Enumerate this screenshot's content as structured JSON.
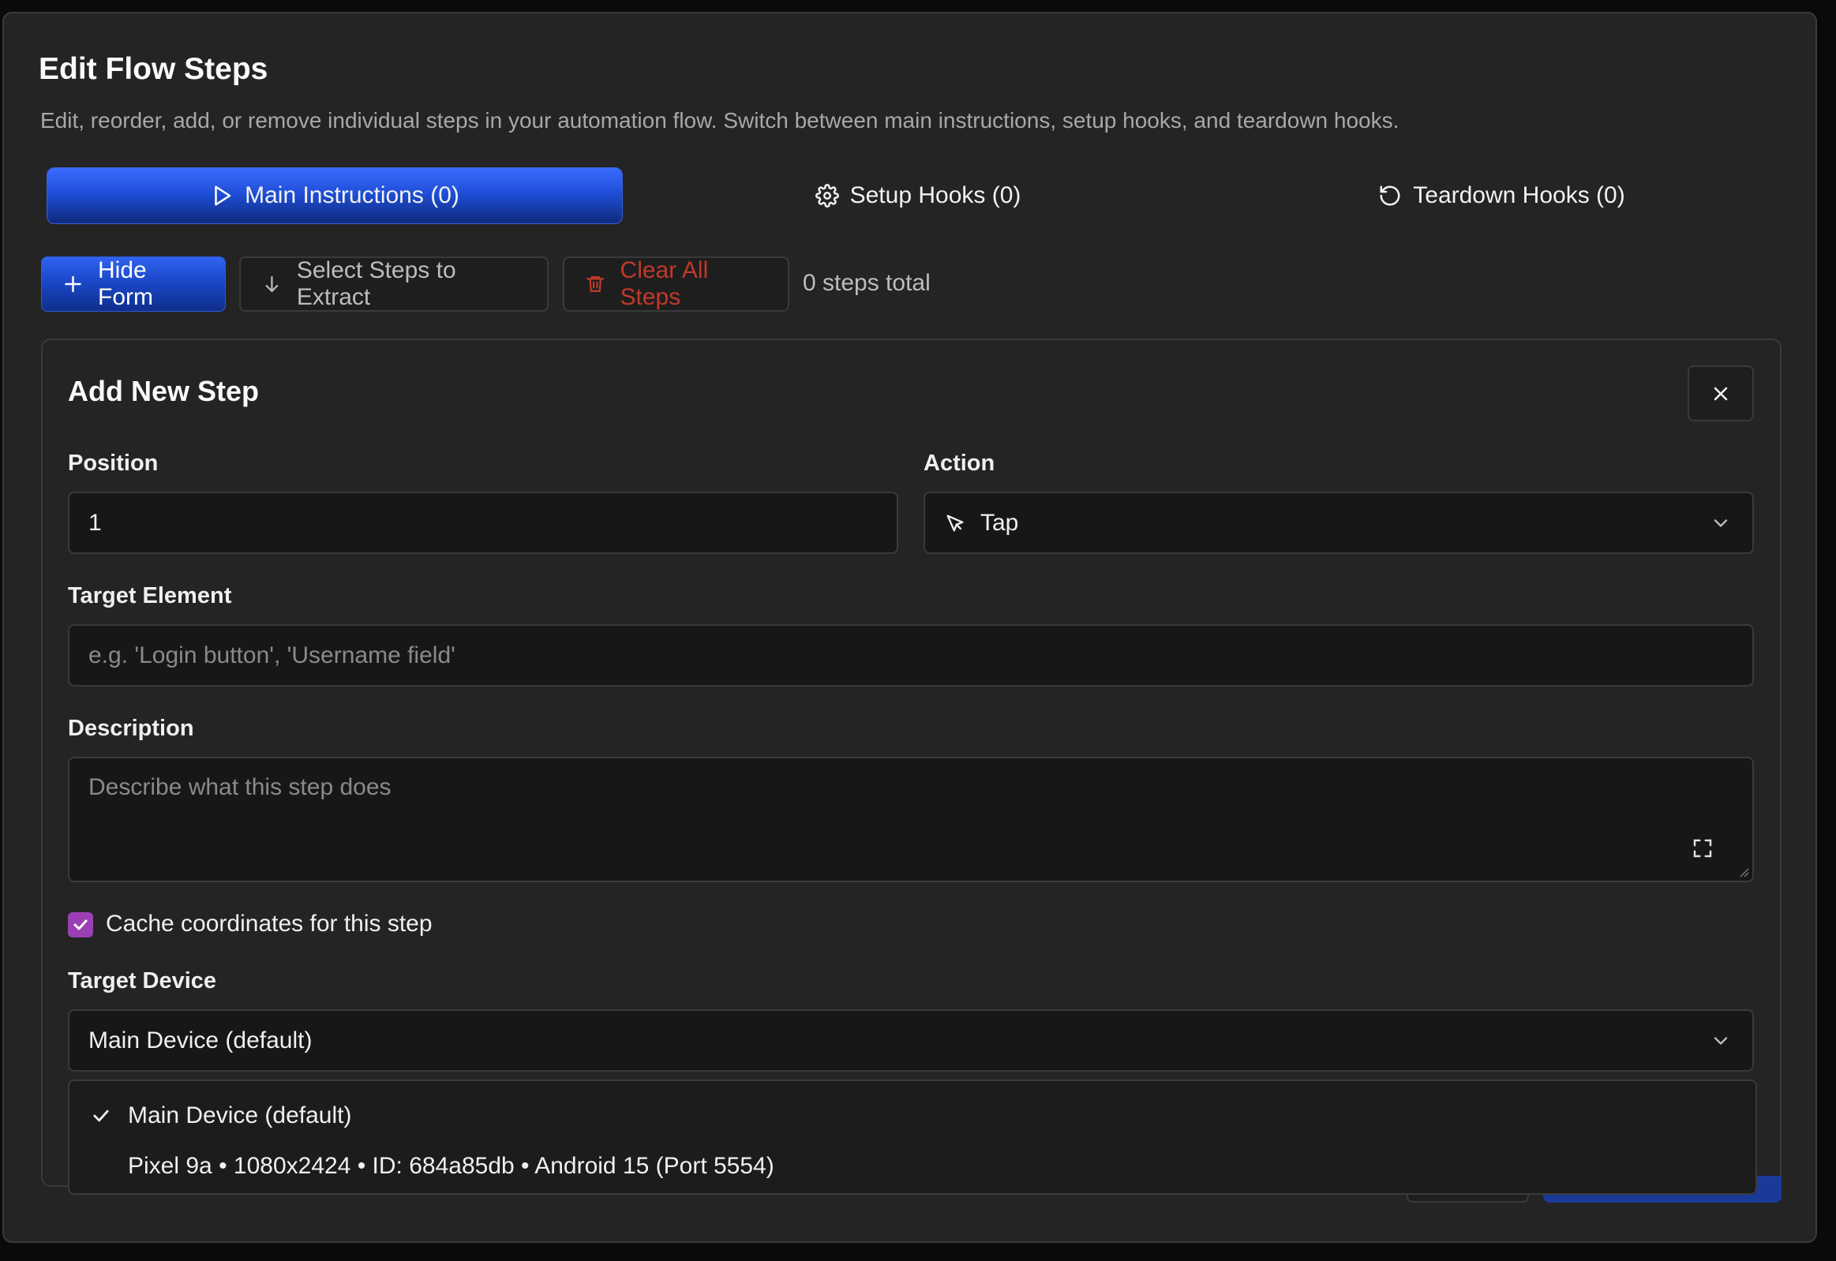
{
  "dialog": {
    "title": "Edit Flow Steps",
    "subtitle": "Edit, reorder, add, or remove individual steps in your automation flow. Switch between main instructions, setup hooks, and teardown hooks."
  },
  "tabs": [
    {
      "label": "Main Instructions (0)",
      "icon": "play-icon",
      "active": true
    },
    {
      "label": "Setup Hooks (0)",
      "icon": "gear-icon",
      "active": false
    },
    {
      "label": "Teardown Hooks (0)",
      "icon": "rotate-ccw-icon",
      "active": false
    }
  ],
  "toolbar": {
    "hide_form": "Hide Form",
    "select_steps": "Select Steps to Extract",
    "clear_all": "Clear All Steps",
    "count": "0 steps total"
  },
  "form": {
    "title": "Add New Step",
    "position_label": "Position",
    "position_value": "1",
    "action_label": "Action",
    "action_value": "Tap",
    "target_label": "Target Element",
    "target_placeholder": "e.g. 'Login button', 'Username field'",
    "description_label": "Description",
    "description_placeholder": "Describe what this step does",
    "cache_label": "Cache coordinates for this step",
    "cache_checked": true,
    "device_label": "Target Device",
    "device_value": "Main Device (default)"
  },
  "device_options": [
    {
      "label": "Main Device (default)",
      "selected": true
    },
    {
      "label": "Pixel 9a • 1080x2424 • ID: 684a85db • Android 15 (Port 5554)",
      "selected": false
    }
  ],
  "colors": {
    "accent": "#2f63f0",
    "danger": "#c0392b",
    "checkbox": "#9b3fb5",
    "background": "#242424"
  }
}
